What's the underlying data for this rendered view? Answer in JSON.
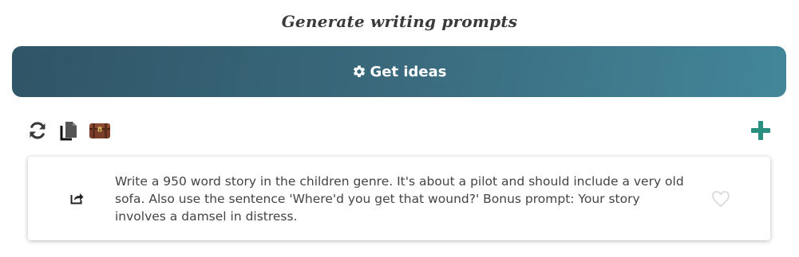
{
  "header": {
    "title": "Generate writing prompts"
  },
  "actions": {
    "get_ideas_label": "Get ideas",
    "gear_icon": "gear-icon"
  },
  "toolbar": {
    "icons": [
      "refresh-icon",
      "copy-icon",
      "chest-icon"
    ],
    "add_icon": "plus-icon"
  },
  "prompt_card": {
    "text": "Write a 950 word story in the children genre. It's about a pilot and should include a very old sofa. Also use the sentence 'Where'd you get that wound?' Bonus prompt: Your story involves a damsel in distress.",
    "share_icon": "share-icon",
    "favorite_icon": "heart-icon"
  },
  "colors": {
    "button_gradient_start": "#2f5567",
    "button_gradient_end": "#43869a",
    "add_accent": "#2a8f7e",
    "text": "#444444"
  }
}
